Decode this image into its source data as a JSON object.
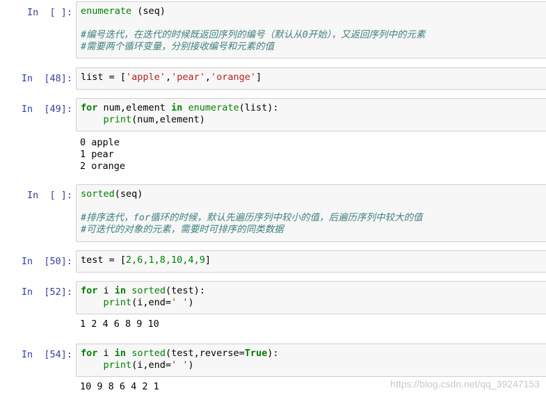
{
  "cells": {
    "c1": {
      "prompt": "In  [ ]:",
      "l1": {
        "a": "enumerate",
        "b": " (seq)"
      },
      "l3": "#编号迭代，在迭代的时候既返回序列的编号（默认从0开始），又返回序列中的元素",
      "l4": "#需要两个循环变量，分别接收编号和元素的值"
    },
    "c2": {
      "prompt": "In  [48]:",
      "l1": {
        "a": "list = [",
        "b": "'apple'",
        "c": ",",
        "d": "'pear'",
        "e": ",",
        "f": "'orange'",
        "g": "]"
      }
    },
    "c3": {
      "prompt": "In  [49]:",
      "l1": {
        "a": "for",
        "b": " num,element ",
        "c": "in",
        "d": " ",
        "e": "enumerate",
        "f": "(list):"
      },
      "l2": {
        "a": "    ",
        "b": "print",
        "c": "(num,element)"
      },
      "out": [
        "0 apple",
        "1 pear",
        "2 orange"
      ]
    },
    "c4": {
      "prompt": "In  [ ]:",
      "l1": {
        "a": "sorted",
        "b": "(seq)"
      },
      "l3": "#排序迭代，for循环的时候，默认先遍历序列中较小的值，后遍历序列中较大的值",
      "l4": "#可迭代的对象的元素，需要时可排序的同类数据"
    },
    "c5": {
      "prompt": "In  [50]:",
      "l1": {
        "a": "test = [",
        "b": "2,6,1,8,10,4,9",
        "c": "]"
      }
    },
    "c6": {
      "prompt": "In  [52]:",
      "l1": {
        "a": "for",
        "b": " i ",
        "c": "in",
        "d": " ",
        "e": "sorted",
        "f": "(test):"
      },
      "l2": {
        "a": "    ",
        "b": "print",
        "c": "(i,end=",
        "d": "' '",
        "e": ")"
      },
      "out": [
        "1 2 4 6 8 9 10"
      ]
    },
    "c7": {
      "prompt": "In  [54]:",
      "l1": {
        "a": "for",
        "b": " i ",
        "c": "in",
        "d": " ",
        "e": "sorted",
        "f": "(test,reverse=",
        "g": "True",
        "h": "):"
      },
      "l2": {
        "a": "    ",
        "b": "print",
        "c": "(i,end=",
        "d": "' '",
        "e": ")"
      },
      "out": [
        "10 9 8 6 4 2 1"
      ]
    }
  },
  "watermark": "https://blog.csdn.net/qq_39247153"
}
